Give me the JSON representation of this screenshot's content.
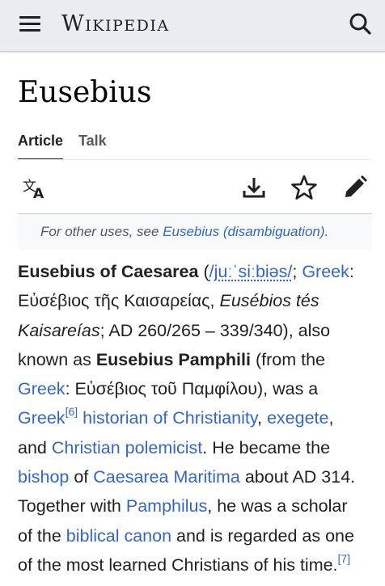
{
  "header": {
    "wordmark": "Wikipedia",
    "icons": [
      "menu-icon",
      "search-icon"
    ]
  },
  "page": {
    "title": "Eusebius",
    "tabs": [
      {
        "label": "Article",
        "active": true
      },
      {
        "label": "Talk",
        "active": false
      }
    ],
    "actions": [
      "language-icon",
      "download-icon",
      "star-icon",
      "edit-icon"
    ]
  },
  "hatnote": {
    "prefix": "For other uses, see ",
    "link": "Eusebius (disambiguation)",
    "suffix": "."
  },
  "article": {
    "l1_bold": "Eusebius of Caesarea",
    "l1_paren_open": " (",
    "l1_ipa": "/juːˈsiːbiəs/",
    "l1_semi": "; ",
    "l1_greek": "Greek",
    "l1_colon": ":",
    "l2_text": "Εὐσέβιος τῆς Καισαρείας, ",
    "l2_italic": "Eusébios tés",
    "l3_italic": "Kaisareías",
    "l3_text": "; AD 260/265 – 339/340), also",
    "l4_text": "known as ",
    "l4_bold": "Eusebius Pamphili",
    "l4_text2": " (from the",
    "l5_greek": "Greek",
    "l5_text": ": Εὐσέβιος τοῦ Παμφίλου), was a",
    "l6_greek": "Greek",
    "l6_ref": "[6]",
    "l6_space": " ",
    "l6_historian": "historian of Christianity",
    "l6_comma": ", ",
    "l6_exegete": "exegete",
    "l6_comma2": ",",
    "l7_and": "and ",
    "l7_polemicist": "Christian polemicist",
    "l7_text": ". He became the",
    "l8_bishop": "bishop",
    "l8_of": " of ",
    "l8_caesarea": "Caesarea Maritima",
    "l8_text": " about AD 314.",
    "l9_text": "Together with ",
    "l9_pamphilus": "Pamphilus",
    "l9_text2": ", he was a scholar",
    "l10_text": "of the ",
    "l10_canon": "biblical canon",
    "l10_text2": " and is regarded as one",
    "l11_text": "of the most learned Christians of his time.",
    "l11_ref": "[7]"
  },
  "colors": {
    "link": "#3366cc",
    "header_bg": "#eaecf0",
    "text": "#202122",
    "muted": "#54595d",
    "hatnote_bg": "#f8f9fa"
  }
}
